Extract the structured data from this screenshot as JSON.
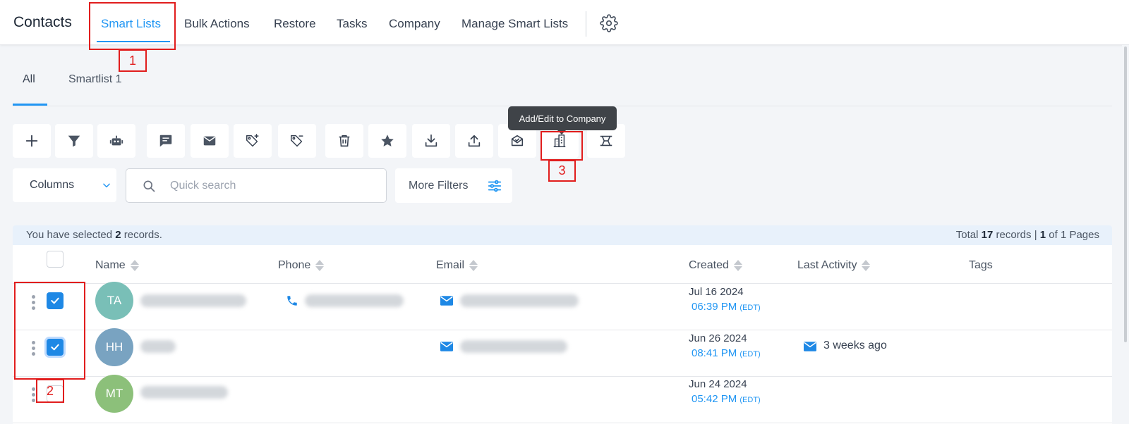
{
  "header": {
    "title": "Contacts",
    "tabs": [
      {
        "label": "Smart Lists",
        "active": true
      },
      {
        "label": "Bulk Actions",
        "active": false
      },
      {
        "label": "Restore",
        "active": false
      },
      {
        "label": "Tasks",
        "active": false
      },
      {
        "label": "Company",
        "active": false
      },
      {
        "label": "Manage Smart Lists",
        "active": false
      }
    ],
    "settings_icon": "gear-icon"
  },
  "subtabs": [
    {
      "label": "All",
      "active": true
    },
    {
      "label": "Smartlist 1",
      "active": false
    }
  ],
  "toolbar": {
    "buttons": [
      "add-icon",
      "filter-icon",
      "robot-icon",
      "message-icon",
      "email-icon",
      "add-tag-icon",
      "remove-tag-icon",
      "delete-icon",
      "star-icon",
      "import-icon",
      "export-icon",
      "review-request-icon",
      "company-icon",
      "merge-icon"
    ],
    "tooltip": "Add/Edit to Company"
  },
  "filters": {
    "columns_label": "Columns",
    "search_placeholder": "Quick search",
    "more_filters_label": "More Filters"
  },
  "selection": {
    "prefix": "You have selected ",
    "count": "2",
    "suffix": " records.",
    "total_prefix": "Total ",
    "total": "17",
    "total_mid": " records | ",
    "page": "1",
    "pages_suffix": " of 1 Pages"
  },
  "table": {
    "columns": [
      "Name",
      "Phone",
      "Email",
      "Created",
      "Last Activity",
      "Tags"
    ],
    "rows": [
      {
        "initials": "TA",
        "avatar_color": "#79bfb7",
        "checked": true,
        "has_phone": true,
        "has_email": true,
        "created_date": "Jul 16 2024",
        "created_time": "06:39 PM",
        "tz": "(EDT)",
        "last_activity": ""
      },
      {
        "initials": "HH",
        "avatar_color": "#79a3c1",
        "checked": true,
        "has_phone": false,
        "has_email": true,
        "created_date": "Jun 26 2024",
        "created_time": "08:41 PM",
        "tz": "(EDT)",
        "last_activity": "3 weeks ago"
      },
      {
        "initials": "MT",
        "avatar_color": "#8cc07a",
        "checked": false,
        "has_phone": false,
        "has_email": false,
        "created_date": "Jun 24 2024",
        "created_time": "05:42 PM",
        "tz": "(EDT)",
        "last_activity": ""
      }
    ]
  },
  "annotations": [
    "1",
    "2",
    "3"
  ],
  "colors": {
    "accent": "#2196f3",
    "annotation": "#e11d1d"
  }
}
